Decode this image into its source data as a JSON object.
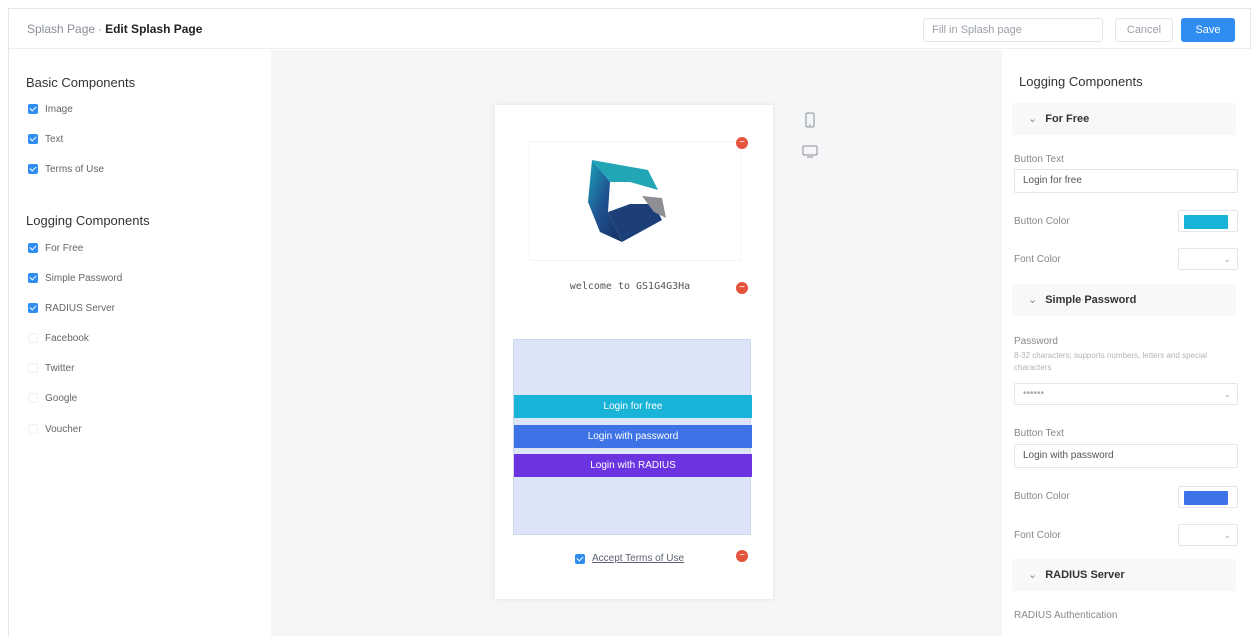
{
  "header": {
    "breadcrumb_parent": "Splash Page",
    "breadcrumb_sep": "·",
    "breadcrumb_current": "Edit Splash Page",
    "name_placeholder": "Fill in Splash page",
    "cancel_label": "Cancel",
    "save_label": "Save"
  },
  "left": {
    "basic_title": "Basic Components",
    "basic_items": [
      {
        "label": "Image",
        "checked": true
      },
      {
        "label": "Text",
        "checked": true
      },
      {
        "label": "Terms of Use",
        "checked": true
      }
    ],
    "logging_title": "Logging Components",
    "logging_items": [
      {
        "label": "For Free",
        "checked": true
      },
      {
        "label": "Simple Password",
        "checked": true
      },
      {
        "label": "RADIUS Server",
        "checked": true
      },
      {
        "label": "Facebook",
        "checked": false
      },
      {
        "label": "Twitter",
        "checked": false
      },
      {
        "label": "Google",
        "checked": false
      },
      {
        "label": "Voucher",
        "checked": false
      }
    ]
  },
  "preview": {
    "welcome_text": "welcome to GS1G4G3Ha",
    "buttons": [
      {
        "label": "Login for free",
        "color": "#1ab3d8"
      },
      {
        "label": "Login with password",
        "color": "#3d73e6"
      },
      {
        "label": "Login with RADIUS",
        "color": "#6b34e0"
      }
    ],
    "terms_label": "Accept Terms of Use",
    "delete_glyph": "−",
    "phone_icon": "mobile-icon",
    "desktop_icon": "desktop-icon"
  },
  "right": {
    "title": "Logging Components",
    "for_free": {
      "section_label": "For Free",
      "button_text_label": "Button Text",
      "button_text_value": "Login for free",
      "button_color_label": "Button Color",
      "button_color": "#1ab3d8",
      "font_color_label": "Font Color"
    },
    "simple_password": {
      "section_label": "Simple Password",
      "password_label": "Password",
      "password_hint": "8-32 characters; supports numbers, letters and special characters",
      "password_value": "••••••",
      "button_text_label": "Button Text",
      "button_text_value": "Login with password",
      "button_color_label": "Button Color",
      "button_color": "#3d73e6",
      "font_color_label": "Font Color"
    },
    "radius": {
      "section_label": "RADIUS Server",
      "auth_label": "RADIUS Authentication"
    },
    "chevron": "⌄"
  },
  "colors": {
    "accent": "#2f8df2",
    "delete": "#e5533d",
    "login_area": "#dbe5f7"
  }
}
